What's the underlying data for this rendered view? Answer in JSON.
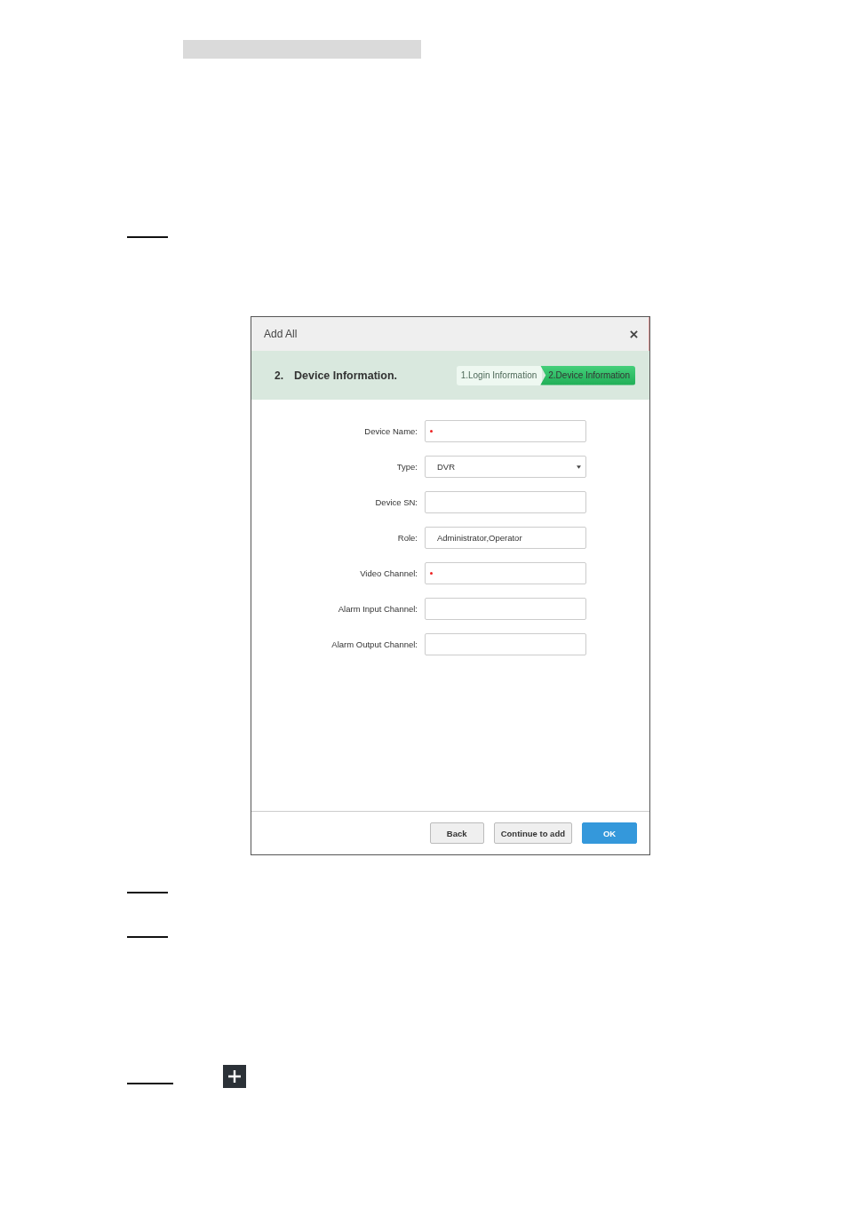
{
  "dialog": {
    "title": "Add All",
    "step_header": {
      "number": "2.",
      "title": "Device Information."
    },
    "steps": [
      {
        "label": "1.Login Information",
        "selected": false
      },
      {
        "label": "2.Device Information",
        "selected": true
      }
    ],
    "fields": [
      {
        "label": "Device Name:",
        "kind": "text",
        "required": true
      },
      {
        "label": "Type:",
        "kind": "select",
        "value": "DVR",
        "required": false
      },
      {
        "label": "Device SN:",
        "kind": "text",
        "required": false
      },
      {
        "label": "Role:",
        "kind": "text",
        "value": "Administrator,Operator",
        "required": false
      },
      {
        "label": "Video Channel:",
        "kind": "text",
        "required": true
      },
      {
        "label": "Alarm Input Channel:",
        "kind": "text",
        "required": false
      },
      {
        "label": "Alarm Output Channel:",
        "kind": "text",
        "required": false
      }
    ],
    "buttons": [
      {
        "label": "Back",
        "kind": "secondary"
      },
      {
        "label": "Continue to add",
        "kind": "secondary"
      },
      {
        "label": "OK",
        "kind": "primary"
      }
    ]
  }
}
